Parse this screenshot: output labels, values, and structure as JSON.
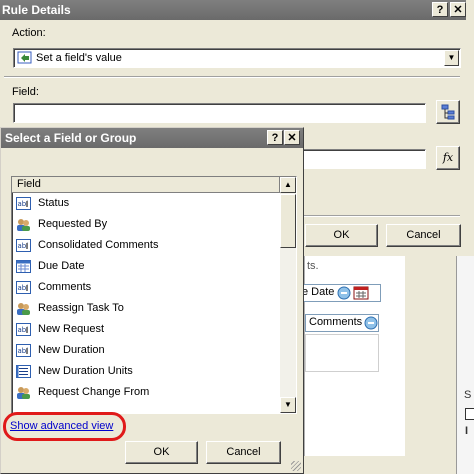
{
  "rule_dialog": {
    "title": "Rule Details",
    "help_label": "?",
    "close_label": "✕",
    "action_label": "Action:",
    "action_value": "Set a field's value",
    "field_label": "Field:",
    "field_value": "",
    "value_value": "",
    "fx_label": "fx",
    "ok_label": "OK",
    "cancel_label": "Cancel"
  },
  "background": {
    "snippet_text": "ts.",
    "date_field_label": "e Date",
    "comments_field_label": "Comments",
    "cut_label_s": "S",
    "cut_label_i": "I"
  },
  "field_dialog": {
    "title": "Select a Field or Group",
    "help_label": "?",
    "close_label": "✕",
    "column_header": "Field",
    "fields": [
      {
        "label": "Status",
        "icon": "text-field-icon"
      },
      {
        "label": "Requested By",
        "icon": "people-field-icon"
      },
      {
        "label": "Consolidated Comments",
        "icon": "text-field-icon"
      },
      {
        "label": "Due Date",
        "icon": "date-field-icon"
      },
      {
        "label": "Comments",
        "icon": "text-field-icon"
      },
      {
        "label": "Reassign Task To",
        "icon": "people-field-icon"
      },
      {
        "label": "New Request",
        "icon": "text-field-icon"
      },
      {
        "label": "New Duration",
        "icon": "text-field-icon"
      },
      {
        "label": "New Duration Units",
        "icon": "list-field-icon"
      },
      {
        "label": "Request Change From",
        "icon": "people-field-icon"
      }
    ],
    "advanced_link": "Show advanced view",
    "ok_label": "OK",
    "cancel_label": "Cancel"
  },
  "colors": {
    "title_bar": "#6f6f6f",
    "dialog_face": "#ece9d8",
    "link": "#0000cc",
    "highlight_circle": "#e01a1a"
  }
}
